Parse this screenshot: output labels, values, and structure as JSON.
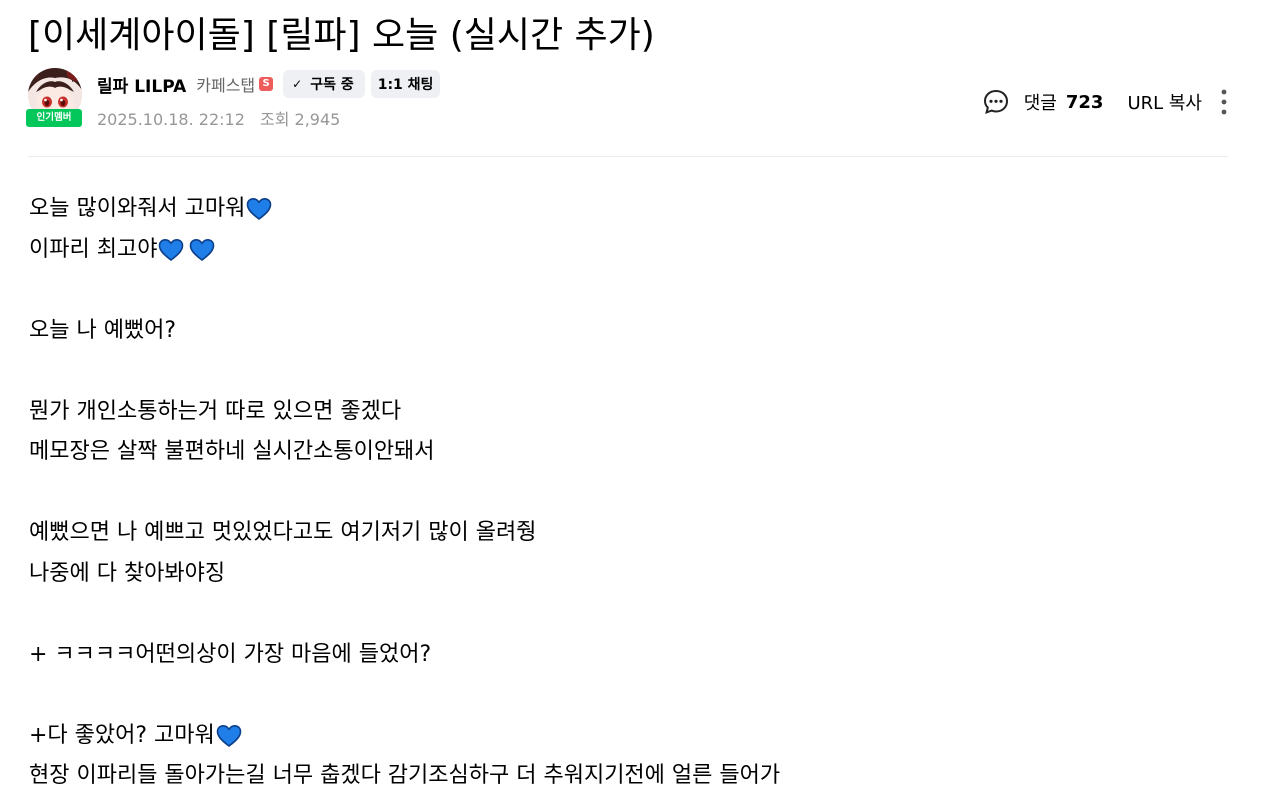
{
  "post": {
    "title": "[이세계아이돌] [릴파] 오늘 (실시간 추가)"
  },
  "author": {
    "nickname": "릴파 LILPA",
    "rank": "카페스탭",
    "rank_icon_letter": "S",
    "member_badge": "인기멤버",
    "subscribe_label": "구독 중",
    "chat_label": "1:1 채팅"
  },
  "meta": {
    "date": "2025.10.18. 22:12",
    "views_label": "조회",
    "views": "2,945"
  },
  "tools": {
    "comment_label": "댓글",
    "comment_count": "723",
    "url_copy_label": "URL 복사"
  },
  "body": {
    "lines": [
      "오늘 많이와줘서 고마워",
      "이파리 최고야",
      "",
      "오늘 나 예뻤어?",
      "",
      "뭔가 개인소통하는거 따로 있으면 좋겠다",
      "메모장은 살짝 불편하네 실시간소통이안돼서",
      "",
      "예뻤으면 나 예쁘고 멋있었다고도 여기저기 많이 올려줭",
      "나중에 다 찾아봐야징",
      "",
      "+ ㅋㅋㅋㅋ어떤의상이 가장 마음에 들었어?",
      "",
      "+다 좋았어? 고마워",
      "현장 이파리들 돌아가는길 너무 춥겠다 감기조심하구 더 추워지기전에 얼른 들어가"
    ]
  },
  "colors": {
    "member_badge": "#03c75a",
    "staff_icon": "#ee5c5c",
    "heart": "#1f7ee8",
    "meta_text": "#979797",
    "button_bg": "#eef0f3"
  },
  "icons": {
    "comment": "speech-bubble-icon",
    "more": "vertical-dots-icon",
    "heart": "blue-heart-emoji",
    "check": "check-icon"
  }
}
